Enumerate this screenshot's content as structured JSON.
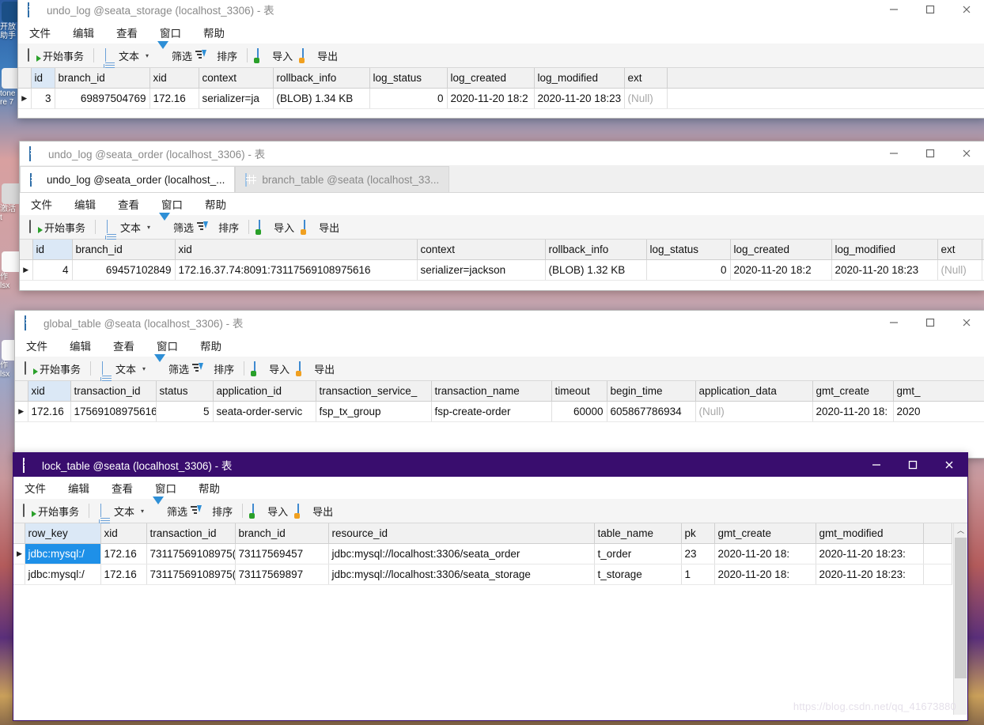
{
  "desktop": {
    "icons": [
      {
        "label": "开放\n助手",
        "color": "#1b4f86"
      },
      {
        "label": "tone\nre 7",
        "color": "#cc2222"
      },
      {
        "label": "激活\nt",
        "color": "#8a8a8a"
      },
      {
        "label": "作\nlsx",
        "color": "#f2f2f2"
      },
      {
        "label": "作\nlsx",
        "color": "#f2f2f2"
      }
    ]
  },
  "common": {
    "menus": [
      "文件",
      "编辑",
      "查看",
      "窗口",
      "帮助"
    ],
    "toolbar": {
      "begin_transaction": "开始事务",
      "text": "文本",
      "filter": "筛选",
      "sort": "排序",
      "import": "导入",
      "export": "导出"
    },
    "window_buttons": {
      "minimize": "minimize",
      "maximize": "maximize",
      "close": "close"
    },
    "null_label": "(Null)"
  },
  "windows": [
    {
      "id": "undo-log-storage",
      "title": "undo_log @seata_storage (localhost_3306) - 表",
      "active": false,
      "grid": {
        "columns": [
          "id",
          "branch_id",
          "xid",
          "context",
          "rollback_info",
          "log_status",
          "log_created",
          "log_modified",
          "ext"
        ],
        "key_column": "id",
        "rows": [
          {
            "id": "3",
            "branch_id": "69897504769",
            "xid": "172.16",
            "context": "serializer=ja",
            "rollback_info": "(BLOB) 1.34 KB",
            "log_status": "0",
            "log_created": "2020-11-20 18:2",
            "log_modified": "2020-11-20 18:23",
            "ext": "(Null)"
          }
        ]
      }
    },
    {
      "id": "undo-log-order",
      "title": "undo_log @seata_order (localhost_3306) - 表",
      "active": false,
      "tabs": [
        {
          "label": "undo_log @seata_order (localhost_...",
          "selected": true
        },
        {
          "label": "branch_table @seata (localhost_33...",
          "selected": false
        }
      ],
      "grid": {
        "columns": [
          "id",
          "branch_id",
          "xid",
          "context",
          "rollback_info",
          "log_status",
          "log_created",
          "log_modified",
          "ext"
        ],
        "key_column": "id",
        "rows": [
          {
            "id": "4",
            "branch_id": "69457102849",
            "xid": "172.16.37.74:8091:73117569108975616",
            "context": "serializer=jackson",
            "rollback_info": "(BLOB) 1.32 KB",
            "log_status": "0",
            "log_created": "2020-11-20 18:2",
            "log_modified": "2020-11-20 18:23",
            "ext": "(Null)"
          }
        ]
      }
    },
    {
      "id": "global-table",
      "title": "global_table @seata (localhost_3306) - 表",
      "active": false,
      "grid": {
        "columns": [
          "xid",
          "transaction_id",
          "status",
          "application_id",
          "transaction_service_",
          "transaction_name",
          "timeout",
          "begin_time",
          "application_data",
          "gmt_create",
          "gmt_"
        ],
        "key_column": "xid",
        "rows": [
          {
            "xid": "172.16",
            "transaction_id": "17569108975616",
            "status": "5",
            "application_id": "seata-order-servic",
            "transaction_service_": "fsp_tx_group",
            "transaction_name": "fsp-create-order",
            "timeout": "60000",
            "begin_time": "605867786934",
            "application_data": "(Null)",
            "gmt_create": "2020-11-20 18:",
            "gmt_": "2020"
          }
        ]
      }
    },
    {
      "id": "lock-table",
      "title": "lock_table @seata (localhost_3306) - 表",
      "active": true,
      "title_color": "#390d6e",
      "grid": {
        "columns": [
          "row_key",
          "xid",
          "transaction_id",
          "branch_id",
          "resource_id",
          "table_name",
          "pk",
          "gmt_create",
          "gmt_modified"
        ],
        "key_column": "row_key",
        "rows": [
          {
            "selected": true,
            "row_key": "jdbc:mysql:/",
            "xid": "172.16",
            "transaction_id": "73117569108975(",
            "branch_id": "73117569457",
            "resource_id": "jdbc:mysql://localhost:3306/seata_order",
            "table_name": "t_order",
            "pk": "23",
            "gmt_create": "2020-11-20 18:",
            "gmt_modified": "2020-11-20 18:23:"
          },
          {
            "selected": false,
            "row_key": "jdbc:mysql:/",
            "xid": "172.16",
            "transaction_id": "73117569108975(",
            "branch_id": "73117569897",
            "resource_id": "jdbc:mysql://localhost:3306/seata_storage",
            "table_name": "t_storage",
            "pk": "1",
            "gmt_create": "2020-11-20 18:",
            "gmt_modified": "2020-11-20 18:23:"
          }
        ]
      }
    }
  ],
  "watermark": "https://blog.csdn.net/qq_41673880"
}
